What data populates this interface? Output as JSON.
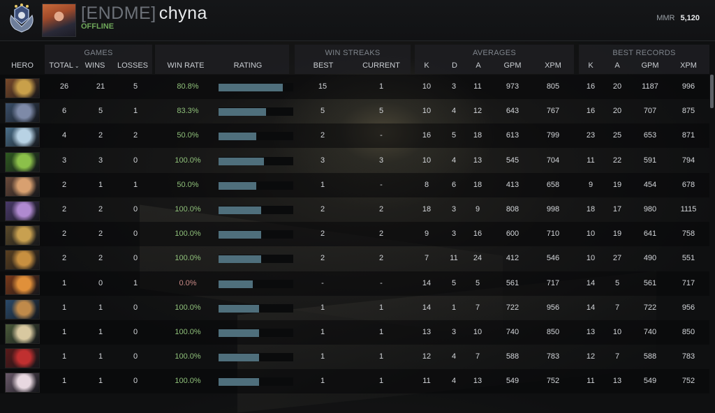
{
  "profile": {
    "clan_tag": "[ENDME]",
    "player_name": "chyna",
    "status": "OFFLINE",
    "mmr_label": "MMR",
    "mmr_value": "5,120",
    "medal_icon": "medal-icon",
    "avatar_icon": "player-avatar"
  },
  "groups": {
    "games": "GAMES",
    "win_streaks": "WIN STREAKS",
    "averages": "AVERAGES",
    "best_records": "BEST RECORDS"
  },
  "columns": {
    "hero": "HERO",
    "total": "TOTAL",
    "total_sort_icon": "chevron-down-icon",
    "wins": "WINS",
    "losses": "LOSSES",
    "win_rate": "WIN RATE",
    "rating": "RATING",
    "best": "BEST",
    "current": "CURRENT",
    "avg_k": "K",
    "avg_d": "D",
    "avg_a": "A",
    "avg_gpm": "GPM",
    "avg_xpm": "XPM",
    "best_k": "K",
    "best_a": "A",
    "best_gpm": "GPM",
    "best_xpm": "XPM"
  },
  "colors": {
    "win_rate_positive": "#8fc07a",
    "win_rate_zero": "#c98a86",
    "rating_bar": "#4f6f7c",
    "status_offline": "#6fa85a"
  },
  "rows": [
    {
      "hero_portrait": "hero-portrait-1",
      "total": "26",
      "wins": "21",
      "losses": "5",
      "win_rate": "80.8%",
      "rating": 0.86,
      "best_streak": "15",
      "current_streak": "1",
      "k": "10",
      "d": "3",
      "a": "11",
      "gpm": "973",
      "xpm": "805",
      "best_k": "16",
      "best_a": "20",
      "best_gpm": "1187",
      "best_xpm": "996"
    },
    {
      "hero_portrait": "hero-portrait-2",
      "total": "6",
      "wins": "5",
      "losses": "1",
      "win_rate": "83.3%",
      "rating": 0.64,
      "best_streak": "5",
      "current_streak": "5",
      "k": "10",
      "d": "4",
      "a": "12",
      "gpm": "643",
      "xpm": "767",
      "best_k": "16",
      "best_a": "20",
      "best_gpm": "707",
      "best_xpm": "875"
    },
    {
      "hero_portrait": "hero-portrait-3",
      "total": "4",
      "wins": "2",
      "losses": "2",
      "win_rate": "50.0%",
      "rating": 0.5,
      "best_streak": "2",
      "current_streak": "-",
      "k": "16",
      "d": "5",
      "a": "18",
      "gpm": "613",
      "xpm": "799",
      "best_k": "23",
      "best_a": "25",
      "best_gpm": "653",
      "best_xpm": "871"
    },
    {
      "hero_portrait": "hero-portrait-4",
      "total": "3",
      "wins": "3",
      "losses": "0",
      "win_rate": "100.0%",
      "rating": 0.61,
      "best_streak": "3",
      "current_streak": "3",
      "k": "10",
      "d": "4",
      "a": "13",
      "gpm": "545",
      "xpm": "704",
      "best_k": "11",
      "best_a": "22",
      "best_gpm": "591",
      "best_xpm": "794"
    },
    {
      "hero_portrait": "hero-portrait-5",
      "total": "2",
      "wins": "1",
      "losses": "1",
      "win_rate": "50.0%",
      "rating": 0.5,
      "best_streak": "1",
      "current_streak": "-",
      "k": "8",
      "d": "6",
      "a": "18",
      "gpm": "413",
      "xpm": "658",
      "best_k": "9",
      "best_a": "19",
      "best_gpm": "454",
      "best_xpm": "678"
    },
    {
      "hero_portrait": "hero-portrait-6",
      "total": "2",
      "wins": "2",
      "losses": "0",
      "win_rate": "100.0%",
      "rating": 0.57,
      "best_streak": "2",
      "current_streak": "2",
      "k": "18",
      "d": "3",
      "a": "9",
      "gpm": "808",
      "xpm": "998",
      "best_k": "18",
      "best_a": "17",
      "best_gpm": "980",
      "best_xpm": "1115"
    },
    {
      "hero_portrait": "hero-portrait-7",
      "total": "2",
      "wins": "2",
      "losses": "0",
      "win_rate": "100.0%",
      "rating": 0.57,
      "best_streak": "2",
      "current_streak": "2",
      "k": "9",
      "d": "3",
      "a": "16",
      "gpm": "600",
      "xpm": "710",
      "best_k": "10",
      "best_a": "19",
      "best_gpm": "641",
      "best_xpm": "758"
    },
    {
      "hero_portrait": "hero-portrait-8",
      "total": "2",
      "wins": "2",
      "losses": "0",
      "win_rate": "100.0%",
      "rating": 0.57,
      "best_streak": "2",
      "current_streak": "2",
      "k": "7",
      "d": "11",
      "a": "24",
      "gpm": "412",
      "xpm": "546",
      "best_k": "10",
      "best_a": "27",
      "best_gpm": "490",
      "best_xpm": "551"
    },
    {
      "hero_portrait": "hero-portrait-9",
      "total": "1",
      "wins": "0",
      "losses": "1",
      "win_rate": "0.0%",
      "rating": 0.46,
      "best_streak": "-",
      "current_streak": "-",
      "k": "14",
      "d": "5",
      "a": "5",
      "gpm": "561",
      "xpm": "717",
      "best_k": "14",
      "best_a": "5",
      "best_gpm": "561",
      "best_xpm": "717"
    },
    {
      "hero_portrait": "hero-portrait-10",
      "total": "1",
      "wins": "1",
      "losses": "0",
      "win_rate": "100.0%",
      "rating": 0.54,
      "best_streak": "1",
      "current_streak": "1",
      "k": "14",
      "d": "1",
      "a": "7",
      "gpm": "722",
      "xpm": "956",
      "best_k": "14",
      "best_a": "7",
      "best_gpm": "722",
      "best_xpm": "956"
    },
    {
      "hero_portrait": "hero-portrait-11",
      "total": "1",
      "wins": "1",
      "losses": "0",
      "win_rate": "100.0%",
      "rating": 0.54,
      "best_streak": "1",
      "current_streak": "1",
      "k": "13",
      "d": "3",
      "a": "10",
      "gpm": "740",
      "xpm": "850",
      "best_k": "13",
      "best_a": "10",
      "best_gpm": "740",
      "best_xpm": "850"
    },
    {
      "hero_portrait": "hero-portrait-12",
      "total": "1",
      "wins": "1",
      "losses": "0",
      "win_rate": "100.0%",
      "rating": 0.54,
      "best_streak": "1",
      "current_streak": "1",
      "k": "12",
      "d": "4",
      "a": "7",
      "gpm": "588",
      "xpm": "783",
      "best_k": "12",
      "best_a": "7",
      "best_gpm": "588",
      "best_xpm": "783"
    },
    {
      "hero_portrait": "hero-portrait-13",
      "total": "1",
      "wins": "1",
      "losses": "0",
      "win_rate": "100.0%",
      "rating": 0.54,
      "best_streak": "1",
      "current_streak": "1",
      "k": "11",
      "d": "4",
      "a": "13",
      "gpm": "549",
      "xpm": "752",
      "best_k": "11",
      "best_a": "13",
      "best_gpm": "549",
      "best_xpm": "752"
    }
  ]
}
